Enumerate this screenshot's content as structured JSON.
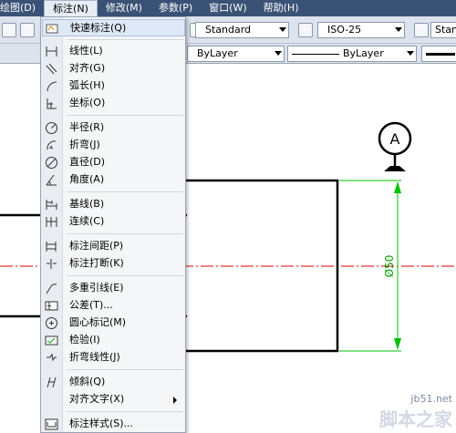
{
  "menubar": {
    "items": [
      {
        "label": "绘图(D)"
      },
      {
        "label": "标注(N)"
      },
      {
        "label": "修改(M)"
      },
      {
        "label": "参数(P)"
      },
      {
        "label": "窗口(W)"
      },
      {
        "label": "帮助(H)"
      }
    ]
  },
  "toolbar": {
    "text_style": "Standard",
    "dim_style": "ISO-25",
    "table_style": "Stan",
    "layer": "ByLayer",
    "linetype": "ByLayer"
  },
  "menu": {
    "items": [
      {
        "label": "快速标注(Q)",
        "icon": "quick-dimension-icon"
      },
      {
        "label": "线性(L)",
        "icon": "linear-icon"
      },
      {
        "label": "对齐(G)",
        "icon": "aligned-icon"
      },
      {
        "label": "弧长(H)",
        "icon": "arc-length-icon"
      },
      {
        "label": "坐标(O)",
        "icon": "ordinate-icon"
      },
      {
        "label": "半径(R)",
        "icon": "radius-icon"
      },
      {
        "label": "折弯(J)",
        "icon": "jogged-icon"
      },
      {
        "label": "直径(D)",
        "icon": "diameter-icon"
      },
      {
        "label": "角度(A)",
        "icon": "angular-icon"
      },
      {
        "label": "基线(B)",
        "icon": "baseline-icon"
      },
      {
        "label": "连续(C)",
        "icon": "continue-icon"
      },
      {
        "label": "标注间距(P)",
        "icon": "dimension-space-icon"
      },
      {
        "label": "标注打断(K)",
        "icon": "dimension-break-icon"
      },
      {
        "label": "多重引线(E)",
        "icon": "multileader-icon"
      },
      {
        "label": "公差(T)...",
        "icon": "tolerance-icon"
      },
      {
        "label": "圆心标记(M)",
        "icon": "center-mark-icon"
      },
      {
        "label": "检验(I)",
        "icon": "inspection-icon"
      },
      {
        "label": "折弯线性(J)",
        "icon": "jogged-linear-icon"
      },
      {
        "label": "倾斜(Q)",
        "icon": "oblique-icon"
      },
      {
        "label": "对齐文字(X)",
        "icon": ""
      },
      {
        "label": "标注样式(S)...",
        "icon": "dimension-style-icon"
      }
    ]
  },
  "drawing": {
    "datum_label": "A",
    "dimension_text": "Ø50"
  },
  "watermark": {
    "site": "jb51.net",
    "brand": "脚本之家"
  },
  "colors": {
    "menubar_bg": "#3a5275",
    "dimension": "#00c000",
    "centerline": "#e00000"
  }
}
